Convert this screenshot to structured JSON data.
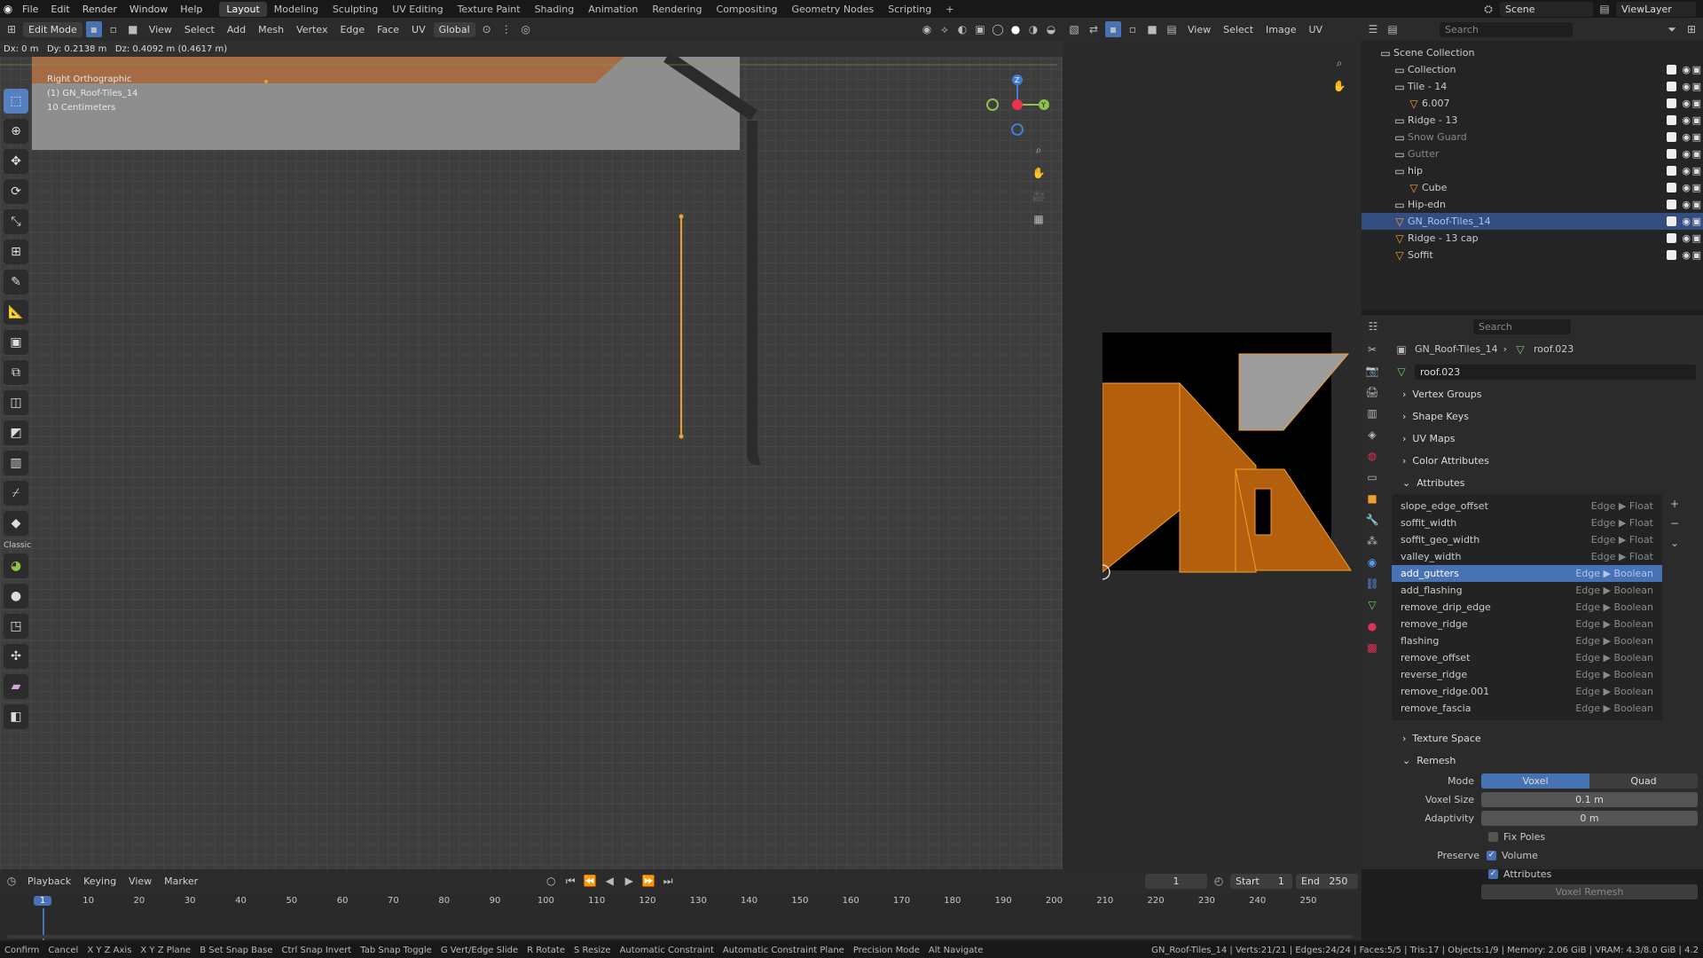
{
  "topbar": {
    "menus": [
      "File",
      "Edit",
      "Render",
      "Window",
      "Help"
    ],
    "workspaces": [
      "Layout",
      "Modeling",
      "Sculpting",
      "UV Editing",
      "Texture Paint",
      "Shading",
      "Animation",
      "Rendering",
      "Compositing",
      "Geometry Nodes",
      "Scripting"
    ],
    "active_workspace": "Layout",
    "scene": "Scene",
    "view_layer": "ViewLayer"
  },
  "viewport": {
    "mode": "Edit Mode",
    "menus": [
      "View",
      "Select",
      "Add",
      "Mesh",
      "Vertex",
      "Edge",
      "Face",
      "UV"
    ],
    "orientation": "Global",
    "transform_readout": "Dx: 0 m   Dy: 0.2138 m   Dz: 0.4092 m (0.4617 m)",
    "overlay_lines": [
      "Right Orthographic",
      "(1) GN_Roof-Tiles_14",
      "10 Centimeters"
    ],
    "gizmo_axes": [
      "Z",
      "Y",
      "X"
    ],
    "axis_colors": {
      "x": "#e8344a",
      "y": "#8bc34a",
      "z": "#3f7fd6"
    },
    "selection_color": "#f2a02c"
  },
  "toolbar": {
    "icons": [
      "select-box-icon",
      "cursor-icon",
      "move-icon",
      "rotate-icon",
      "scale-icon",
      "transform-icon",
      "annotate-icon",
      "measure-icon",
      "add-cube-icon",
      "extrude-icon",
      "inset-icon",
      "bevel-icon",
      "loop-cut-icon",
      "knife-icon",
      "poly-build-icon",
      "spin-icon",
      "smooth-icon",
      "edge-slide-icon",
      "shrink-icon",
      "shear-icon",
      "rip-icon"
    ],
    "classic_label": "Classic"
  },
  "uv_editor": {
    "menus": [
      "View",
      "Select",
      "Image",
      "UV"
    ]
  },
  "outliner": {
    "search_placeholder": "Search",
    "items": [
      {
        "label": "Scene Collection",
        "indent": 0
      },
      {
        "label": "Collection",
        "indent": 1
      },
      {
        "label": "Tile - 14",
        "indent": 1
      },
      {
        "label": "6.007",
        "indent": 2
      },
      {
        "label": "Ridge - 13",
        "indent": 1
      },
      {
        "label": "Snow Guard",
        "indent": 1
      },
      {
        "label": "Gutter",
        "indent": 1
      },
      {
        "label": "hip",
        "indent": 1
      },
      {
        "label": "Cube",
        "indent": 2
      },
      {
        "label": "Hip-edn",
        "indent": 1
      },
      {
        "label": "GN_Roof-Tiles_14",
        "indent": 1,
        "selected": true
      },
      {
        "label": "Ridge - 13 cap",
        "indent": 1
      },
      {
        "label": "Soffit",
        "indent": 1
      }
    ]
  },
  "properties": {
    "search_placeholder": "Search",
    "breadcrumb_object": "GN_Roof-Tiles_14",
    "breadcrumb_mesh": "roof.023",
    "mesh_name": "roof.023",
    "panels": [
      "Vertex Groups",
      "Shape Keys",
      "UV Maps",
      "Color Attributes"
    ],
    "attributes_header": "Attributes",
    "attributes": [
      {
        "name": "slope_edge_offset",
        "domain": "Edge",
        "type": "Float"
      },
      {
        "name": "soffit_width",
        "domain": "Edge",
        "type": "Float"
      },
      {
        "name": "soffit_geo_width",
        "domain": "Edge",
        "type": "Float"
      },
      {
        "name": "valley_width",
        "domain": "Edge",
        "type": "Float"
      },
      {
        "name": "add_gutters",
        "domain": "Edge",
        "type": "Boolean",
        "selected": true
      },
      {
        "name": "add_flashing",
        "domain": "Edge",
        "type": "Boolean"
      },
      {
        "name": "remove_drip_edge",
        "domain": "Edge",
        "type": "Boolean"
      },
      {
        "name": "remove_ridge",
        "domain": "Edge",
        "type": "Boolean"
      },
      {
        "name": "flashing",
        "domain": "Edge",
        "type": "Boolean"
      },
      {
        "name": "remove_offset",
        "domain": "Edge",
        "type": "Boolean"
      },
      {
        "name": "reverse_ridge",
        "domain": "Edge",
        "type": "Boolean"
      },
      {
        "name": "remove_ridge.001",
        "domain": "Edge",
        "type": "Boolean"
      },
      {
        "name": "remove_fascia",
        "domain": "Edge",
        "type": "Boolean"
      }
    ],
    "texture_space": "Texture Space",
    "remesh": {
      "header": "Remesh",
      "mode_label": "Mode",
      "mode_options": [
        "Voxel",
        "Quad"
      ],
      "mode_active": "Voxel",
      "voxel_size_label": "Voxel Size",
      "voxel_size": "0.1 m",
      "adaptivity_label": "Adaptivity",
      "adaptivity": "0 m",
      "fix_poles": "Fix Poles",
      "preserve_label": "Preserve",
      "volume": "Volume",
      "attributes": "Attributes",
      "voxel_remesh_button": "Voxel Remesh"
    }
  },
  "timeline": {
    "menus": [
      "Playback",
      "Keying",
      "View",
      "Marker"
    ],
    "current_frame": "1",
    "start_label": "Start",
    "start": "1",
    "end_label": "End",
    "end": "250",
    "ticks": [
      1,
      10,
      20,
      30,
      40,
      50,
      60,
      70,
      80,
      90,
      100,
      110,
      120,
      130,
      140,
      150,
      160,
      170,
      180,
      190,
      200,
      210,
      220,
      230,
      240,
      250
    ]
  },
  "statusbar": {
    "items": [
      "Confirm",
      "Cancel",
      "X Y Z Axis",
      "X Y Z Plane",
      "B Set Snap Base",
      "Ctrl Snap Invert",
      "Tab Snap Toggle",
      "G Vert/Edge Slide",
      "R Rotate",
      "S Resize",
      "Automatic Constraint",
      "Automatic Constraint Plane",
      "Precision Mode",
      "Alt Navigate"
    ],
    "stats": "GN_Roof-Tiles_14 | Verts:21/21 | Edges:24/24 | Faces:5/5 | Tris:17 | Objects:1/9 | Memory: 2.06 GiB | VRAM: 4.3/8.0 GiB | 4.2"
  }
}
